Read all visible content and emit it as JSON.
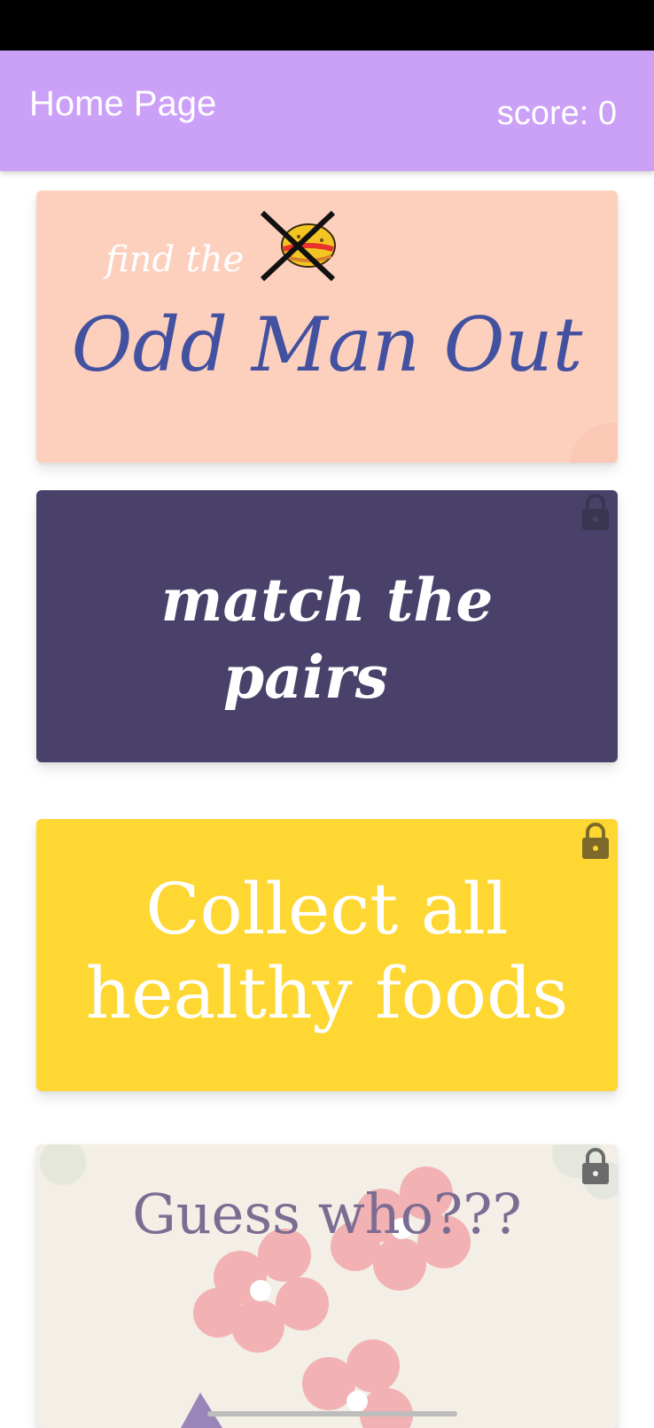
{
  "app_bar": {
    "title": "Home Page",
    "score": "score: 0"
  },
  "cards": [
    {
      "id": "odd-man-out",
      "subtitle": "find the",
      "title": "Odd Man Out",
      "background": "#fdd0be",
      "locked": false
    },
    {
      "id": "match-the-pairs",
      "title_line1": "match the",
      "title_line2": "pairs",
      "background": "#4a416b",
      "locked": true
    },
    {
      "id": "collect-healthy-foods",
      "title_line1": "Collect all",
      "title_line2": "healthy foods",
      "background": "#fed732",
      "locked": true
    },
    {
      "id": "guess-who",
      "title": "Guess who???",
      "background": "#f3eee6",
      "locked": true
    }
  ],
  "icons": [
    "burger-icon",
    "cross-icon",
    "lock-icon"
  ],
  "colors": {
    "app_bar": "#cba0f7",
    "title_blue": "#4351a1",
    "lock_grey": "#6b6b6b"
  }
}
